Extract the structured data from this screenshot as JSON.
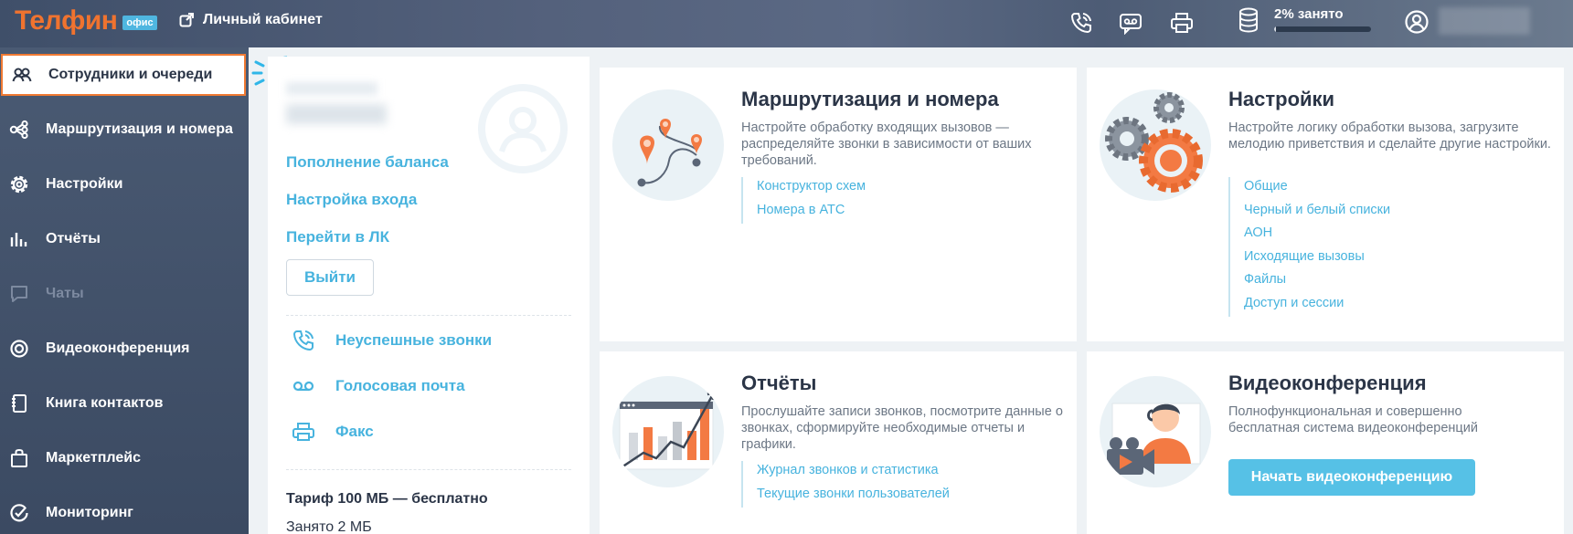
{
  "header": {
    "logo_text": "Телфин",
    "logo_badge": "офис",
    "personal_cabinet": "Личный кабинет",
    "storage_label": "2% занято",
    "storage_fraction": 0.02,
    "icons": [
      "phone-icon",
      "voicemail-icon",
      "printer-icon",
      "database-icon",
      "user-icon"
    ]
  },
  "sidebar": {
    "items": [
      {
        "label": "Сотрудники и очереди",
        "icon": "users-icon",
        "state": "active"
      },
      {
        "label": "Маршрутизация и номера",
        "icon": "routing-icon"
      },
      {
        "label": "Настройки",
        "icon": "gear-icon"
      },
      {
        "label": "Отчёты",
        "icon": "bar-chart-icon"
      },
      {
        "label": "Чаты",
        "icon": "chat-icon",
        "state": "disabled"
      },
      {
        "label": "Видеоконференция",
        "icon": "video-icon"
      },
      {
        "label": "Книга контактов",
        "icon": "contacts-book-icon"
      },
      {
        "label": "Маркетплейс",
        "icon": "bag-icon"
      },
      {
        "label": "Мониторинг",
        "icon": "monitoring-icon"
      }
    ]
  },
  "account": {
    "links": [
      "Пополнение баланса",
      "Настройка входа",
      "Перейти в ЛК"
    ],
    "logout": "Выйти",
    "actions": [
      {
        "label": "Неуспешные звонки",
        "icon": "missed-call-icon"
      },
      {
        "label": "Голосовая почта",
        "icon": "voicemail-icon"
      },
      {
        "label": "Факс",
        "icon": "fax-icon"
      }
    ],
    "tariff": "Тариф 100 МБ — бесплатно",
    "used": "Занято 2 МБ"
  },
  "cards": {
    "routing": {
      "title": "Маршрутизация и номера",
      "description": "Настройте обработку входящих вызовов — распределяйте звонки в зависимости от ваших требований.",
      "links": [
        "Конструктор схем",
        "Номера в АТС"
      ]
    },
    "settings": {
      "title": "Настройки",
      "description": "Настройте логику обработки вызова, загрузите мелодию приветствия и сделайте другие настройки.",
      "links": [
        "Общие",
        "Черный и белый списки",
        "АОН",
        "Исходящие вызовы",
        "Файлы",
        "Доступ и сессии"
      ]
    },
    "reports": {
      "title": "Отчёты",
      "description": "Прослушайте записи звонков, посмотрите данные о звонках, сформируйте необходимые отчеты и графики.",
      "links": [
        "Журнал звонков и статистика",
        "Текущие звонки пользователей"
      ]
    },
    "video": {
      "title": "Видеоконференция",
      "description": "Полнофункциональная и совершенно бесплатная система видеоконференций",
      "button": "Начать видеоконференцию"
    }
  },
  "colors": {
    "accent": "#47b3de",
    "brand_orange": "#f0732f",
    "sidebar_bg": "#455470",
    "active_border": "#f07a33"
  }
}
